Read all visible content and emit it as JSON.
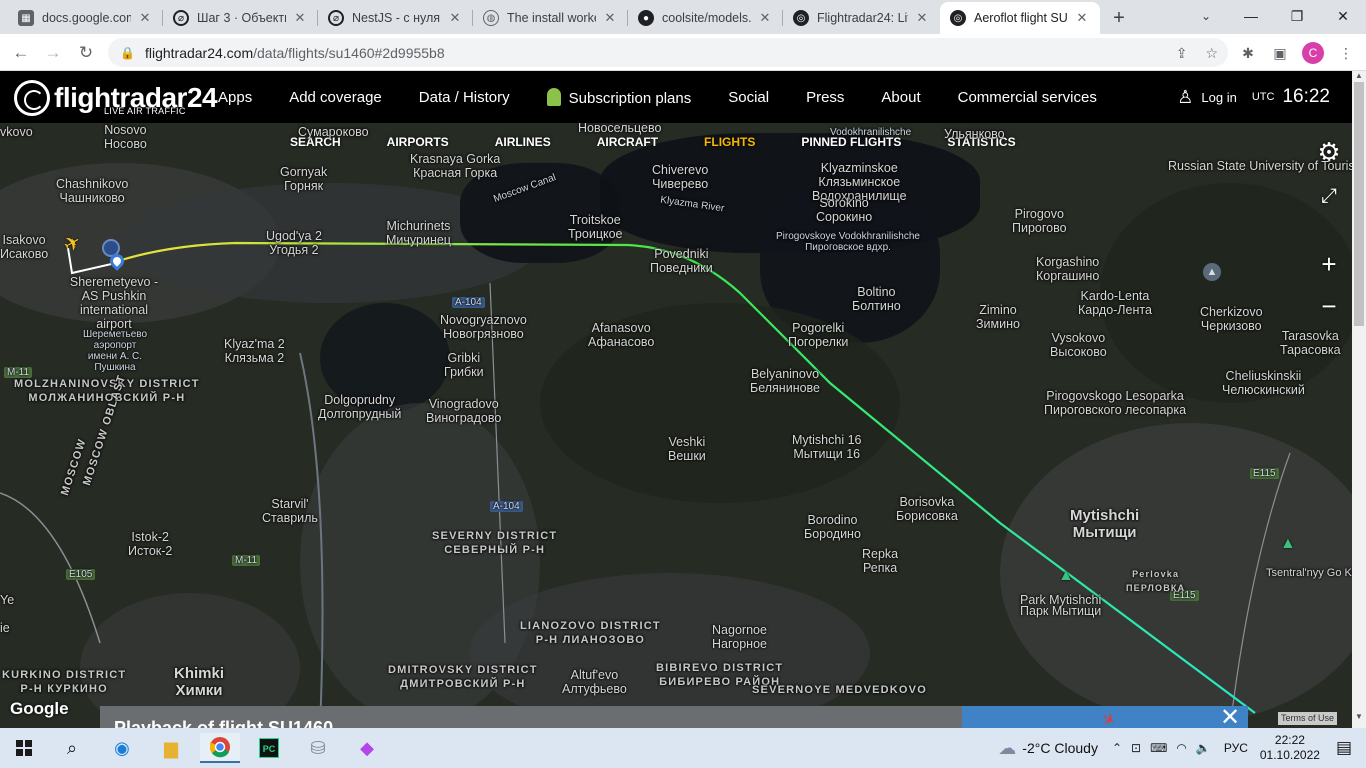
{
  "browser": {
    "tabs": [
      {
        "title": "docs.google.com",
        "icon": "google-docs-icon"
      },
      {
        "title": "Шаг 3 · Объекты",
        "icon": "stepik-icon"
      },
      {
        "title": "NestJS - с нуля, с",
        "icon": "stepik-icon"
      },
      {
        "title": "The install worke",
        "icon": "globe-icon"
      },
      {
        "title": "coolsite/models.p",
        "icon": "github-icon"
      },
      {
        "title": "Flightradar24: Liv",
        "icon": "flightradar-icon"
      },
      {
        "title": "Aeroflot flight SU",
        "icon": "flightradar-icon"
      }
    ],
    "url_host": "flightradar24.com",
    "url_path": "/data/flights/su1460#2d9955b8",
    "profile_letter": "C"
  },
  "header": {
    "logo": "flightradar24",
    "logo_sub": "LIVE AIR TRAFFIC",
    "nav": [
      "Apps",
      "Add coverage",
      "Data / History",
      "Subscription plans",
      "Social",
      "Press",
      "About",
      "Commercial services"
    ],
    "login": "Log in",
    "utc": "UTC",
    "time": "16:22"
  },
  "subnav": {
    "items": [
      "SEARCH",
      "AIRPORTS",
      "AIRLINES",
      "AIRCRAFT",
      "FLIGHTS",
      "PINNED FLIGHTS",
      "STATISTICS"
    ],
    "active": "FLIGHTS"
  },
  "map": {
    "labels": [
      "Nosovo",
      "Носово",
      "Новосельцево",
      "Chashnikovo",
      "Чашниково",
      "Gornyak",
      "Горняк",
      "Krasnaya Gorka",
      "Красная Горка",
      "Chiverevo",
      "Чиверево",
      "Klyazminskoe",
      "Клязьминское",
      "Водохранилище",
      "Sorokino",
      "Сорокино",
      "Russian State University of Tourism and Service",
      "Isakovo",
      "Исаково",
      "Ugod'ya 2",
      "Угодья 2",
      "Michurinets",
      "Мичуринец",
      "Troitskoe",
      "Троицкое",
      "Povedniki",
      "Поведники",
      "Pirogovo",
      "Пирогово",
      "Korgashino",
      "Коргашино",
      "Kardo-Lenta",
      "Кардо-Лента",
      "Cherkizovo",
      "Черкизово",
      "Sheremetyevo - AS Pushkin international airport",
      "Шереметьево аэропорт имени А. С. Пушкина",
      "Boltino",
      "Болтино",
      "Zimino",
      "Зимино",
      "Vysokovo",
      "Высоково",
      "Tarasovka",
      "Тарасовка",
      "Novogryaznovo",
      "Новогрязново",
      "Afanasovo",
      "Афанасово",
      "Pogorelki",
      "Погорелки",
      "Klyaz'ma 2",
      "Клязьма 2",
      "Gribki",
      "Грибки",
      "Belyaninovo",
      "Белянинове",
      "Cheliuskinskii",
      "Челюскинский",
      "MOLZHANINOVSKY DISTRICT",
      "МОЛЖАНИНОВСКИЙ Р-Н",
      "Dolgoprudny",
      "Долгопрудный",
      "Vinogradovo",
      "Виноградово",
      "Pirogovskogo Lesoparka",
      "Пироговского лесопарка",
      "Veshki",
      "Вешки",
      "Mytishchi 16",
      "Мытищи 16",
      "MOSCOW OBLAST",
      "MOSCOW",
      "Starvil'",
      "Ставриль",
      "Borisovka",
      "Борисовка",
      "Mytishchi",
      "Мытищи",
      "Istok-2",
      "Исток-2",
      "SEVERNY DISTRICT",
      "СЕВЕРНЫЙ Р-Н",
      "Borodino",
      "Бородино",
      "Repka",
      "Репка",
      "Park Mytishchi",
      "Парк Мытищи",
      "Tsentral'nyy Go Korolev",
      "LIANOZOVO DISTRICT",
      "Р-Н ЛИАНОЗОВО",
      "Nagornoe",
      "Нагорное",
      "Altuf'evo",
      "Алтуфьево",
      "KURKINO DISTRICT",
      "Р-Н КУРКИНО",
      "Khimki",
      "Химки",
      "DMITROVSKY DISTRICT",
      "ДМИТРОВСКИЙ Р-Н",
      "BIBIREVO DISTRICT",
      "БИБИРЕВО РАЙОН",
      "SEVERNOYE MEDVEDKOVO",
      "Moscow Canal",
      "Klyazma River",
      "Pirogovskoye Vodokhranilishche",
      "Пироговское вдхр.",
      "A-104",
      "M-11",
      "E105",
      "E115",
      "ПЕРЛОВКА",
      "Perlovka",
      "Vodokhranilishche",
      "Сумароково",
      "Ульянково",
      "Ye",
      "ie",
      "vkovo"
    ],
    "flight_path_colors": {
      "start": "#f6e23a",
      "mid": "#3ee84a",
      "end": "#27e8c8"
    },
    "google": "Google",
    "terms": "Terms of Use",
    "panel_title": "Playback of flight SU1460"
  },
  "taskbar": {
    "weather_temp": "-2°C",
    "weather_desc": "Cloudy",
    "lang": "РУС",
    "time": "22:22",
    "date": "01.10.2022"
  }
}
